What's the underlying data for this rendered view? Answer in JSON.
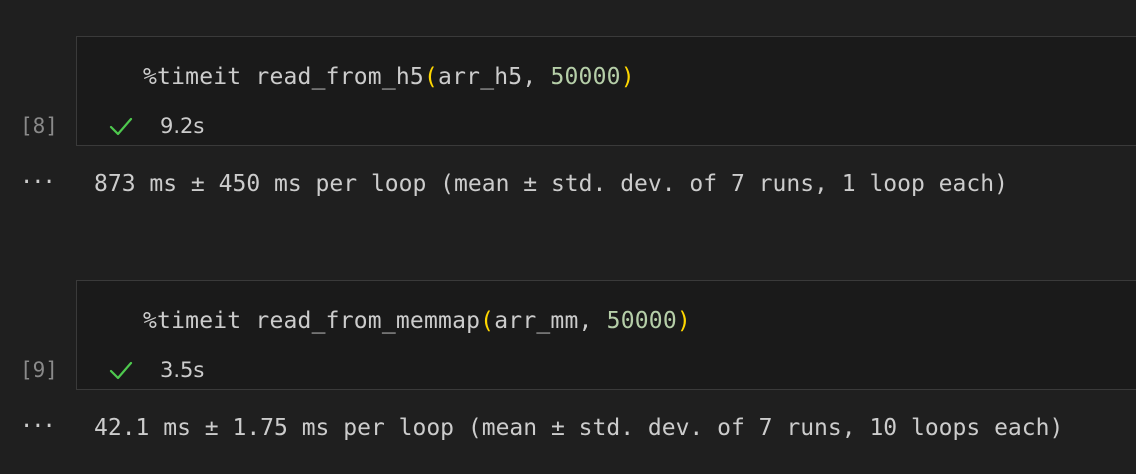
{
  "cells": [
    {
      "execution_count": "[8]",
      "code": {
        "magic": "%timeit",
        "function": "read_from_h5",
        "open_paren": "(",
        "arg1": "arr_h5",
        "sep": ", ",
        "arg2": "50000",
        "close_paren": ")"
      },
      "status_icon": "check-icon",
      "duration": "9.2s",
      "output_more_icon": "ellipsis-icon",
      "output": "873 ms ± 450 ms per loop (mean ± std. dev. of 7 runs, 1 loop each)"
    },
    {
      "execution_count": "[9]",
      "code": {
        "magic": "%timeit",
        "function": "read_from_memmap",
        "open_paren": "(",
        "arg1": "arr_mm",
        "sep": ", ",
        "arg2": "50000",
        "close_paren": ")"
      },
      "status_icon": "check-icon",
      "duration": "3.5s",
      "output_more_icon": "ellipsis-icon",
      "output": "42.1 ms ± 1.75 ms per loop (mean ± std. dev. of 7 runs, 10 loops each)"
    }
  ],
  "colors": {
    "background": "#1f1f1f",
    "code_background": "#1a1a1a",
    "border": "#3a3a3a",
    "text": "#cccccc",
    "bracket": "#ffd700",
    "number": "#b5cea8",
    "success": "#4ec94e",
    "muted": "#8a8a8a"
  }
}
